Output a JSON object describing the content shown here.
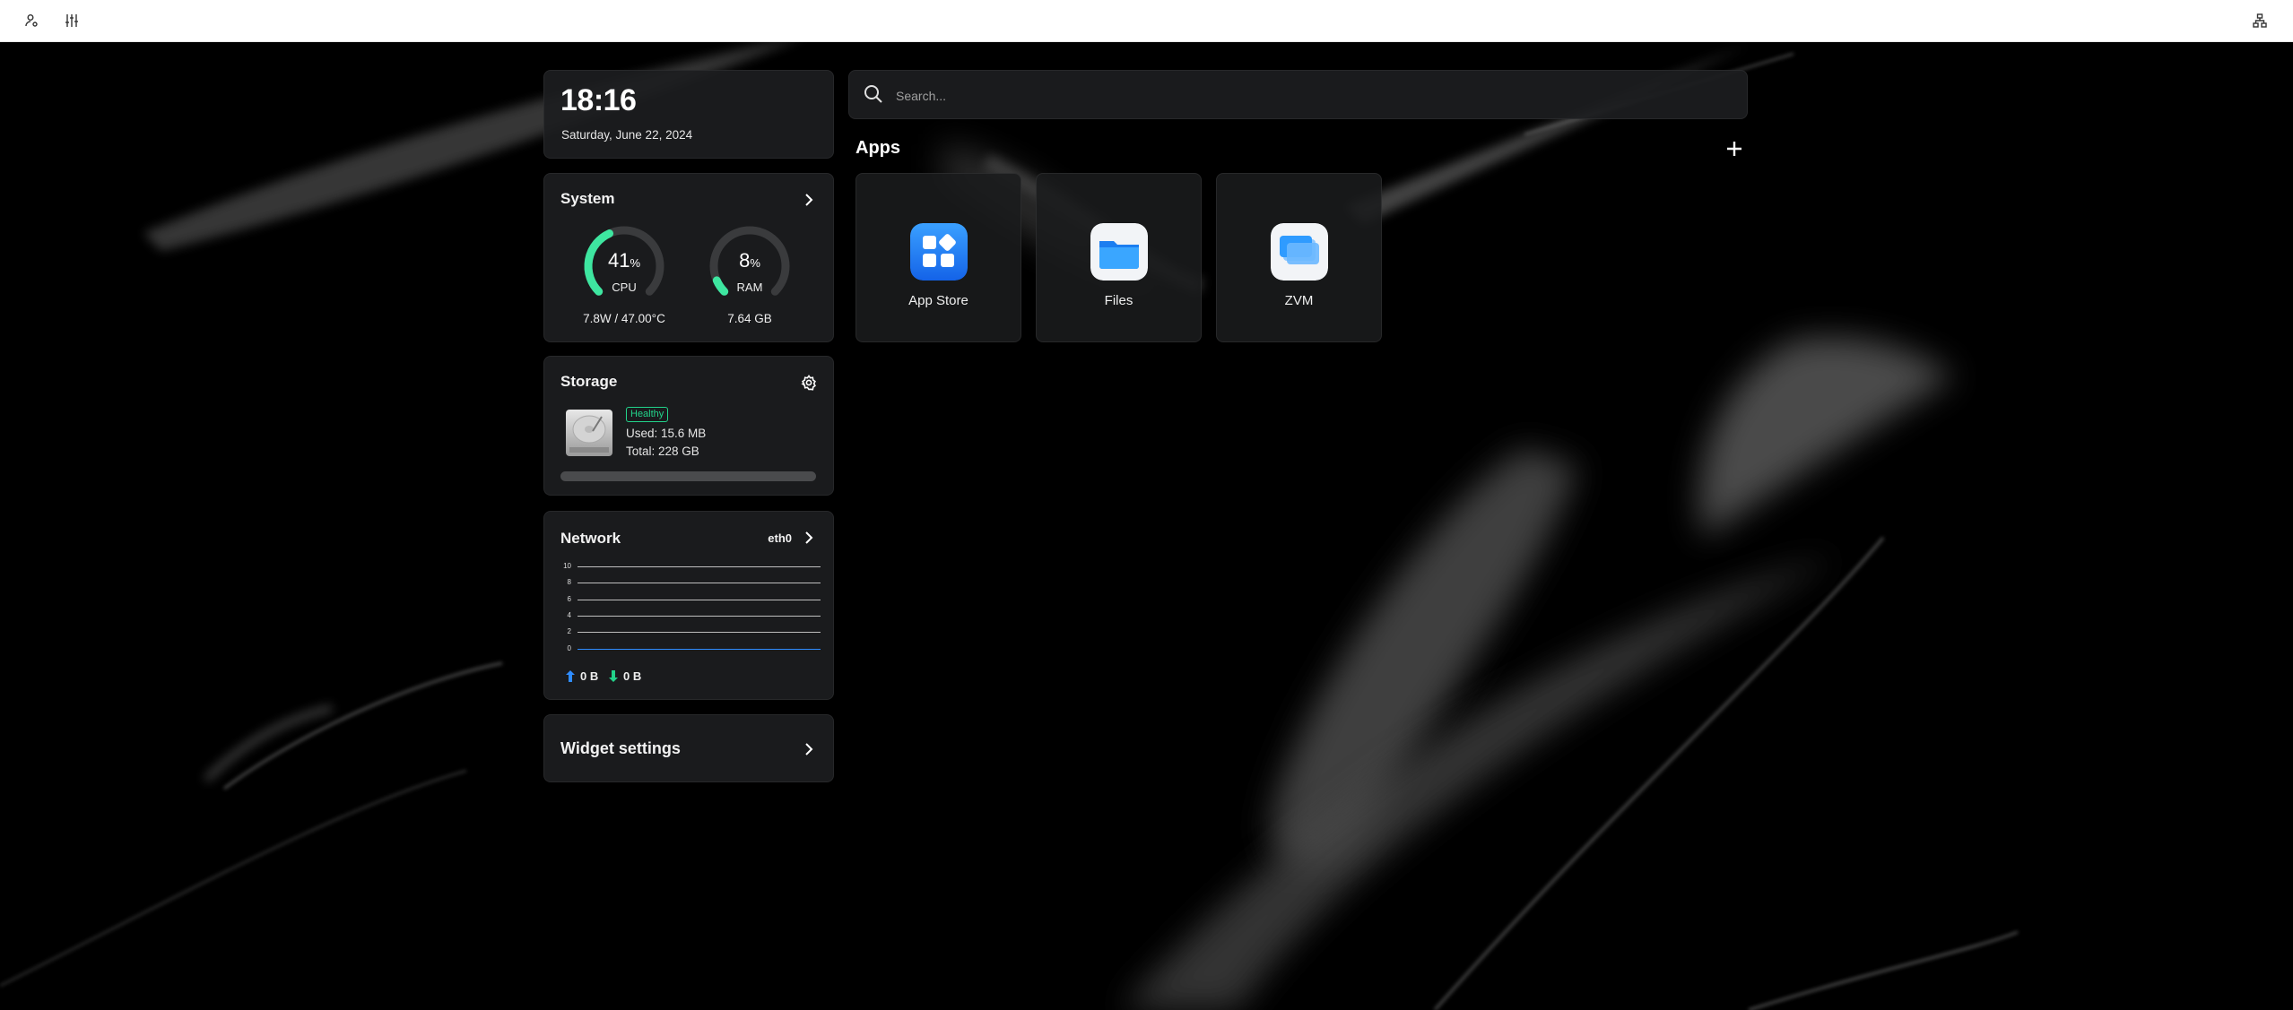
{
  "topbar": {
    "left_icons": [
      "user-settings-icon",
      "sliders-icon"
    ],
    "right_icons": [
      "network-tree-icon"
    ]
  },
  "clock": {
    "time": "18:16",
    "date": "Saturday, June 22, 2024"
  },
  "system": {
    "title": "System",
    "cpu": {
      "value": "41",
      "unit": "%",
      "label": "CPU",
      "detail": "7.8W / 47.00°C",
      "percent": 41
    },
    "ram": {
      "value": "8",
      "unit": "%",
      "label": "RAM",
      "detail": "7.64 GB",
      "percent": 8
    }
  },
  "storage": {
    "title": "Storage",
    "status": "Healthy",
    "used": "Used: 15.6 MB",
    "total": "Total: 228 GB",
    "usage_fraction": 0.0001
  },
  "network": {
    "title": "Network",
    "interface": "eth0",
    "y_ticks": [
      "10",
      "8",
      "6",
      "4",
      "2",
      "0"
    ],
    "upload": "0 B",
    "download": "0 B"
  },
  "widget_settings": {
    "label": "Widget settings"
  },
  "search": {
    "placeholder": "Search..."
  },
  "apps": {
    "title": "Apps",
    "items": [
      {
        "name": "App Store",
        "icon": "app-store-icon"
      },
      {
        "name": "Files",
        "icon": "folder-icon"
      },
      {
        "name": "ZVM",
        "icon": "zvm-icon"
      }
    ]
  },
  "colors": {
    "accent_green": "#3ee6a0",
    "upload_blue": "#2f8cff",
    "download_green": "#22d38a",
    "card_bg": "#1c1d1f"
  }
}
